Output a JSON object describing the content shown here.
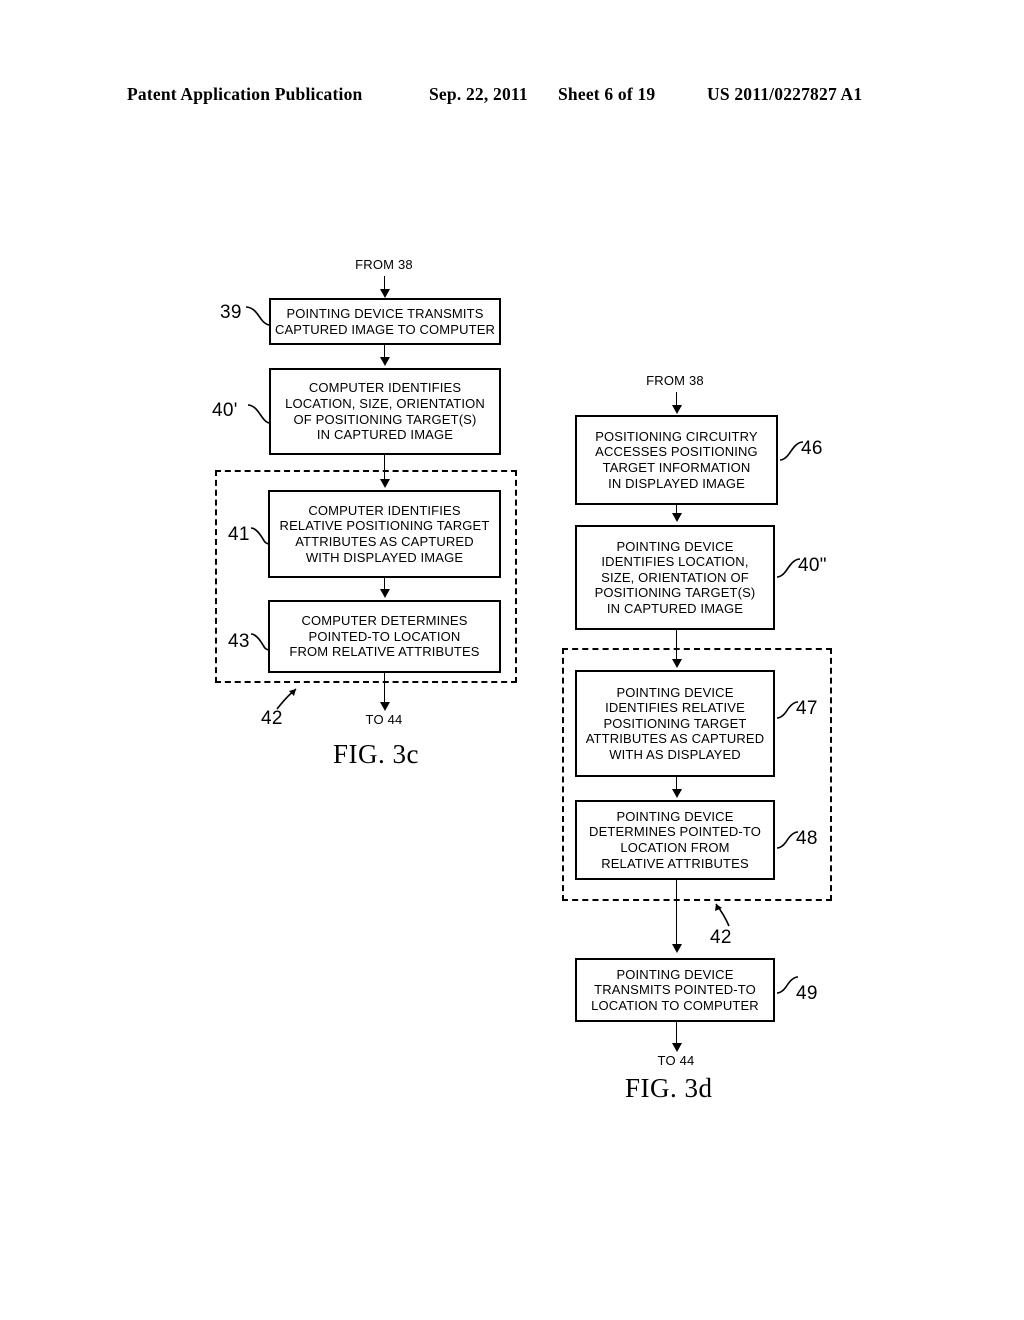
{
  "header": {
    "publication": "Patent Application Publication",
    "date": "Sep. 22, 2011",
    "sheet": "Sheet 6 of 19",
    "number": "US 2011/0227827 A1"
  },
  "figures": [
    {
      "id": "fig-3c",
      "caption": "FIG. 3c",
      "entry_label": "FROM 38",
      "exit_label": "TO 44",
      "group_ref": "42",
      "nodes": [
        {
          "ref": "39",
          "lines": [
            "POINTING DEVICE TRANSMITS",
            "CAPTURED IMAGE TO COMPUTER"
          ]
        },
        {
          "ref": "40'",
          "lines": [
            "COMPUTER IDENTIFIES",
            "LOCATION, SIZE, ORIENTATION",
            "OF POSITIONING TARGET(S)",
            "IN CAPTURED IMAGE"
          ]
        },
        {
          "ref": "41",
          "lines": [
            "COMPUTER IDENTIFIES",
            "RELATIVE POSITIONING TARGET",
            "ATTRIBUTES AS CAPTURED",
            "WITH DISPLAYED IMAGE"
          ]
        },
        {
          "ref": "43",
          "lines": [
            "COMPUTER DETERMINES",
            "POINTED-TO LOCATION",
            "FROM RELATIVE ATTRIBUTES"
          ]
        }
      ]
    },
    {
      "id": "fig-3d",
      "caption": "FIG. 3d",
      "entry_label": "FROM 38",
      "exit_label": "TO 44",
      "group_ref": "42",
      "nodes": [
        {
          "ref": "46",
          "lines": [
            "POSITIONING CIRCUITRY",
            "ACCESSES POSITIONING",
            "TARGET INFORMATION",
            "IN DISPLAYED IMAGE"
          ]
        },
        {
          "ref": "40\"",
          "lines": [
            "POINTING DEVICE",
            "IDENTIFIES LOCATION,",
            "SIZE, ORIENTATION OF",
            "POSITIONING TARGET(S)",
            "IN CAPTURED IMAGE"
          ]
        },
        {
          "ref": "47",
          "lines": [
            "POINTING DEVICE",
            "IDENTIFIES RELATIVE",
            "POSITIONING TARGET",
            "ATTRIBUTES AS CAPTURED",
            "WITH AS DISPLAYED"
          ]
        },
        {
          "ref": "48",
          "lines": [
            "POINTING DEVICE",
            "DETERMINES POINTED-TO",
            "LOCATION FROM",
            "RELATIVE ATTRIBUTES"
          ]
        },
        {
          "ref": "49",
          "lines": [
            "POINTING DEVICE",
            "TRANSMITS POINTED-TO",
            "LOCATION TO COMPUTER"
          ]
        }
      ]
    }
  ],
  "colors": {
    "ink": "#000000",
    "paper": "#ffffff"
  }
}
